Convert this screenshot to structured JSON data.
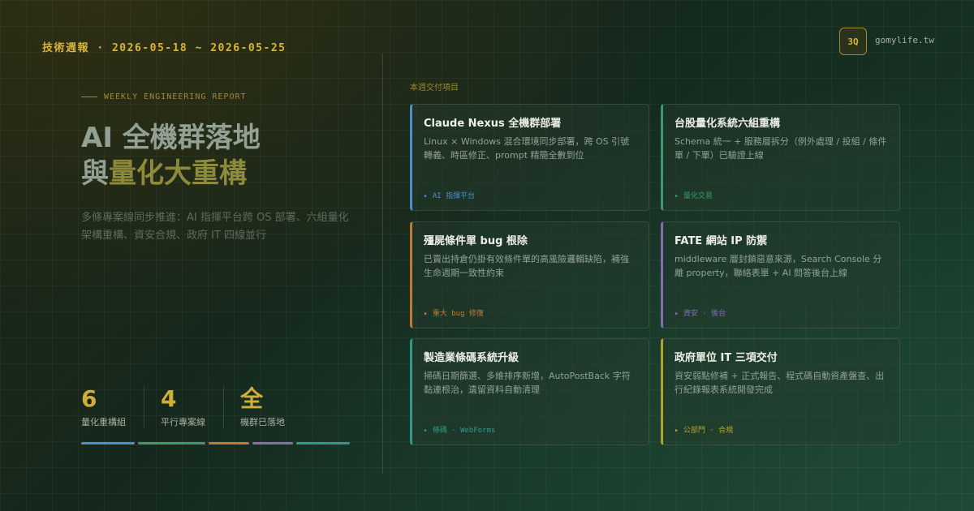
{
  "header": {
    "title": "技術週報 · 2026-05-18 ~ 2026-05-25",
    "logo_text": "3Q",
    "domain": "gomylife.tw"
  },
  "left": {
    "eyebrow": "WEEKLY ENGINEERING REPORT",
    "hero_line1": "AI 全機群落地",
    "hero_line2_a": "與",
    "hero_line2_b": "量化大重構",
    "subtitle": "多條專案線同步推進：AI 指揮平台跨 OS 部署、六組量化架構重構、資安合規、政府 IT 四線並行",
    "stats": [
      {
        "value": "6",
        "label": "量化重構組"
      },
      {
        "value": "4",
        "label": "平行專案線"
      },
      {
        "value": "全",
        "label": "機群已落地"
      }
    ],
    "bar_colors": [
      "#4a8fd0",
      "#3d9a6a",
      "#c07a35",
      "#8a6ab8",
      "#2e9a8a"
    ]
  },
  "section_label": "本週交付項目",
  "cards": [
    {
      "title": "Claude Nexus 全機群部署",
      "desc": "Linux × Windows 混合環境同步部署，跨 OS 引號轉義、時區修正、prompt 精簡全數到位",
      "tag": "▸ AI 指揮平台",
      "color": "#4a8fd0"
    },
    {
      "title": "台股量化系統六組重構",
      "desc": "Schema 統一 + 服務層拆分（例外處理 / 投組 / 條件單 / 下單）已驗證上線",
      "tag": "▸ 量化交易",
      "color": "#3d9a6a"
    },
    {
      "title": "殭屍條件單 bug 根除",
      "desc": "已賣出持倉仍掛有效條件單的高風險邏輯缺陷，補強生命週期一致性約束",
      "tag": "▸ 重大 bug 修復",
      "color": "#c07a35"
    },
    {
      "title": "FATE 網站 IP 防禦",
      "desc": "middleware 層封鎖惡意來源，Search Console 分離 property，聯絡表單 + AI 問答後台上線",
      "tag": "▸ 資安 · 後台",
      "color": "#8a6ab8"
    },
    {
      "title": "製造業條碼系統升級",
      "desc": "掃碼日期篩選、多維排序新增，AutoPostBack 字符黏連根治，遺留資料自動清理",
      "tag": "▸ 條碼 · WebForms",
      "color": "#2e9a8a"
    },
    {
      "title": "政府單位 IT 三項交付",
      "desc": "資安弱點修補 + 正式報告、程式碼自動資產盤查、出行紀錄報表系統開發完成",
      "tag": "▸ 公部門 · 合規",
      "color": "#b5a030"
    }
  ]
}
